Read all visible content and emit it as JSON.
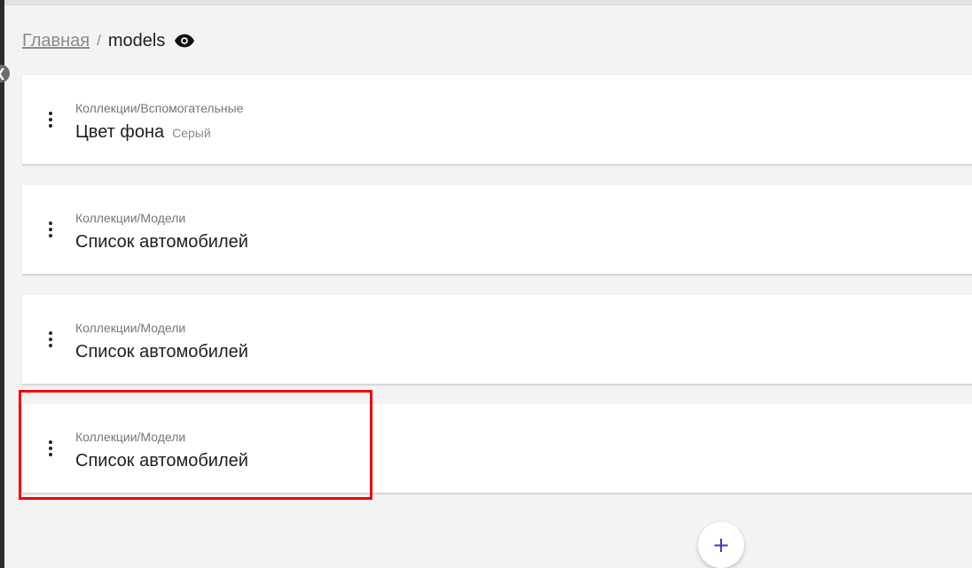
{
  "breadcrumb": {
    "home": "Главная",
    "separator": "/",
    "current": "models"
  },
  "icons": {
    "collapse": "chevron-left-icon",
    "visibility": "eye-icon",
    "card_menu": "more-vertical-icon",
    "add": "plus-icon"
  },
  "cards": [
    {
      "path": "Коллекции/Вспомогательные",
      "title": "Цвет фона",
      "value": "Серый"
    },
    {
      "path": "Коллекции/Модели",
      "title": "Список автомобилей",
      "value": ""
    },
    {
      "path": "Коллекции/Модели",
      "title": "Список автомобилей",
      "value": ""
    },
    {
      "path": "Коллекции/Модели",
      "title": "Список автомобилей",
      "value": ""
    }
  ],
  "add_button": {
    "label": "+"
  },
  "colors": {
    "background": "#f3f3f3",
    "highlight": "#f40000",
    "accent": "#3a3ab0"
  }
}
